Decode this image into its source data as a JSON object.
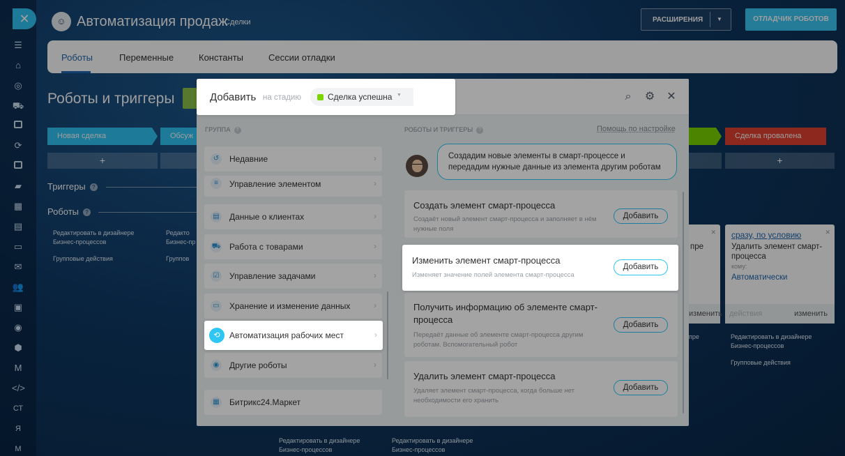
{
  "app": {
    "title": "Автоматизация продаж",
    "subtitle": "Сделки",
    "extensions_label": "РАСШИРЕНИЯ",
    "debugger_label": "ОТЛАДЧИК РОБОТОВ"
  },
  "sidebar": {
    "close_glyph": "✕",
    "text_items": [
      "СТ",
      "Я",
      "М"
    ]
  },
  "tabs": [
    "Роботы",
    "Переменные",
    "Константы",
    "Сессии отладки"
  ],
  "page": {
    "heading": "Роботы и триггеры",
    "stages": {
      "new": "Новая сделка",
      "discussion": "Обсуж",
      "failed": "Сделка провалена"
    },
    "plus": "+",
    "triggers_label": "Триггеры",
    "robots_label": "Роботы",
    "help_mark": "?",
    "edit_in_designer_line1": "Редактировать в дизайнере",
    "edit_in_designer_line2": "Бизнес-процессов",
    "edit_short_line1": "Редакто",
    "edit_short_line2": "Бизнес-пр",
    "group_actions": "Групповые действия",
    "group_actions_short": "Группов",
    "edit_right_line1": "Редактировать в дизайнере",
    "edit_right_line2": "Бизнес-процессов",
    "edit_frag": "пре",
    "bottom_edit_line1": "Редактировать в дизайнере",
    "bottom_edit_line2": "Бизнес-процессов"
  },
  "robot_card": {
    "condition": "сразу, по условию",
    "text": "Удалить элемент смарт-процесса",
    "to_label": "кому:",
    "auto": "Автоматически",
    "actions": "действия",
    "change": "изменить",
    "frag_text": "пре",
    "frag_change": "изменить"
  },
  "modal": {
    "title": "Добавить",
    "at_stage": "на стадию",
    "stage": "Сделка успешна",
    "stage_color": "#7bd500",
    "group_label": "ГРУППА",
    "robots_label": "РОБОТЫ И ТРИГГЕРЫ",
    "help_link": "Помощь по настройке",
    "groups": [
      {
        "label": "Недавние",
        "icon": "history-icon"
      },
      {
        "label": "Управление элементом",
        "icon": "filter-icon"
      },
      {
        "label": "Данные о клиентах",
        "icon": "contact-card-icon"
      },
      {
        "label": "Работа с товарами",
        "icon": "cart-icon"
      },
      {
        "label": "Управление задачами",
        "icon": "task-icon"
      },
      {
        "label": "Хранение и изменение данных",
        "icon": "drive-icon"
      },
      {
        "label": "Автоматизация рабочих мест",
        "icon": "automation-icon"
      },
      {
        "label": "Другие роботы",
        "icon": "robot-icon"
      }
    ],
    "market": "Битрикс24.Маркет",
    "assistant_text": "Создадим новые элементы в смарт-процессе и передадим нужные данные из элемента другим роботам",
    "add_label": "Добавить",
    "actions": [
      {
        "title": "Создать элемент смарт-процесса",
        "desc": "Создаёт новый элемент смарт-процесса и заполняет в нём нужные поля"
      },
      {
        "title": "Изменить элемент смарт-процесса",
        "desc": "Изменяет значение полей элемента смарт-процесса"
      },
      {
        "title": "Получить информацию об элементе смарт-процесса",
        "desc": "Передаёт данные об элементе смарт-процесса другим роботам. Вспомогательный робот"
      },
      {
        "title": "Удалить элемент смарт-процесса",
        "desc": "Удаляет элемент смарт-процесса, когда больше нет необходимости его хранить"
      }
    ]
  }
}
